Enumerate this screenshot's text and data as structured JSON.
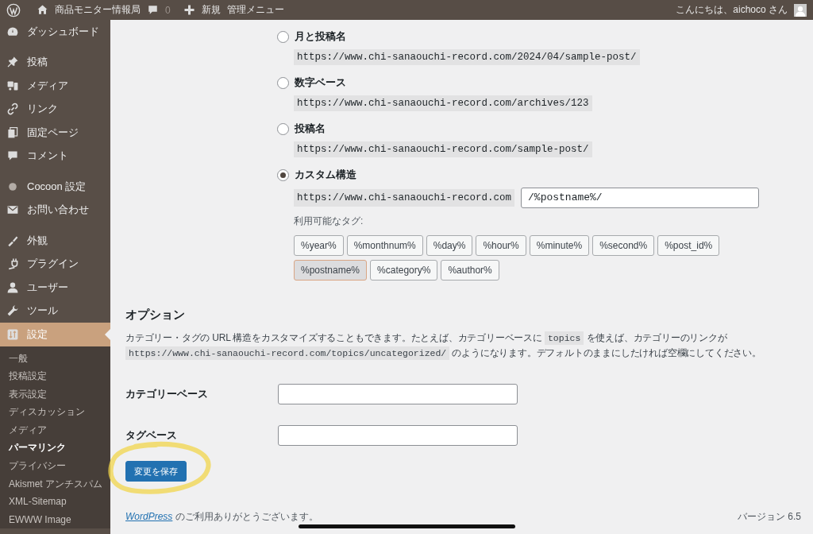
{
  "admin_bar": {
    "site_name": "商品モニター情報局",
    "comments": "0",
    "new_label": "新規",
    "admin_menu": "管理メニュー",
    "greeting": "こんにちは、aichoco さん"
  },
  "sidebar": {
    "groups": [
      {
        "items": [
          {
            "label": "ダッシュボード",
            "selected": false
          }
        ]
      },
      {
        "items": [
          {
            "label": "投稿",
            "selected": false
          },
          {
            "label": "メディア",
            "selected": false
          },
          {
            "label": "リンク",
            "selected": false
          },
          {
            "label": "固定ページ",
            "selected": false
          },
          {
            "label": "コメント",
            "selected": false
          }
        ]
      },
      {
        "items": [
          {
            "label": "Cocoon 設定",
            "selected": false
          },
          {
            "label": "お問い合わせ",
            "selected": false
          }
        ]
      },
      {
        "items": [
          {
            "label": "外観",
            "selected": false
          },
          {
            "label": "プラグイン",
            "selected": false
          },
          {
            "label": "ユーザー",
            "selected": false
          },
          {
            "label": "ツール",
            "selected": false
          },
          {
            "label": "設定",
            "selected": true,
            "children": [
              {
                "label": "一般",
                "selected": false
              },
              {
                "label": "投稿設定",
                "selected": false
              },
              {
                "label": "表示設定",
                "selected": false
              },
              {
                "label": "ディスカッション",
                "selected": false
              },
              {
                "label": "メディア",
                "selected": false
              },
              {
                "label": "パーマリンク",
                "selected": true
              },
              {
                "label": "プライバシー",
                "selected": false
              },
              {
                "label": "Akismet アンチスパム",
                "selected": false
              },
              {
                "label": "XML-Sitemap",
                "selected": false
              },
              {
                "label": "EWWW Image",
                "selected": false
              }
            ]
          }
        ]
      }
    ]
  },
  "permalink_options": [
    {
      "kind": "preset",
      "label": "月と投稿名",
      "selected": false,
      "example": "https://www.chi-sanaouchi-record.com/2024/04/sample-post/"
    },
    {
      "kind": "preset",
      "label": "数字ベース",
      "selected": false,
      "example": "https://www.chi-sanaouchi-record.com/archives/123"
    },
    {
      "kind": "preset",
      "label": "投稿名",
      "selected": false,
      "example": "https://www.chi-sanaouchi-record.com/sample-post/"
    },
    {
      "kind": "custom",
      "label": "カスタム構造",
      "selected": true,
      "prefix": "https://www.chi-sanaouchi-record.com",
      "value": "/%postname%/"
    }
  ],
  "available_tags": {
    "label": "利用可能なタグ:",
    "tags": [
      {
        "label": "%year%",
        "selected": false
      },
      {
        "label": "%monthnum%",
        "selected": false
      },
      {
        "label": "%day%",
        "selected": false
      },
      {
        "label": "%hour%",
        "selected": false
      },
      {
        "label": "%minute%",
        "selected": false
      },
      {
        "label": "%second%",
        "selected": false
      },
      {
        "label": "%post_id%",
        "selected": false
      },
      {
        "label": "%postname%",
        "selected": true
      },
      {
        "label": "%category%",
        "selected": false
      },
      {
        "label": "%author%",
        "selected": false
      }
    ]
  },
  "options": {
    "heading": "オプション",
    "description": [
      {
        "kind": "text",
        "text": "カテゴリー・タグの URL 構造をカスタマイズすることもできます。たとえば、カテゴリーベースに "
      },
      {
        "kind": "code",
        "text": "topics"
      },
      {
        "kind": "text",
        "text": " を使えば、カテゴリーのリンクが "
      },
      {
        "kind": "code",
        "text": "https://www.chi-sanaouchi-record.com/topics/uncategorized/"
      },
      {
        "kind": "text",
        "text": " のようになります。デフォルトのままにしたければ空欄にしてください。"
      }
    ],
    "fields": [
      {
        "label": "カテゴリーベース"
      },
      {
        "label": "タグベース"
      }
    ]
  },
  "save_button": "変更を保存",
  "footer": {
    "link": "WordPress",
    "text": " のご利用ありがとうございます。",
    "version": "バージョン 6.5"
  }
}
